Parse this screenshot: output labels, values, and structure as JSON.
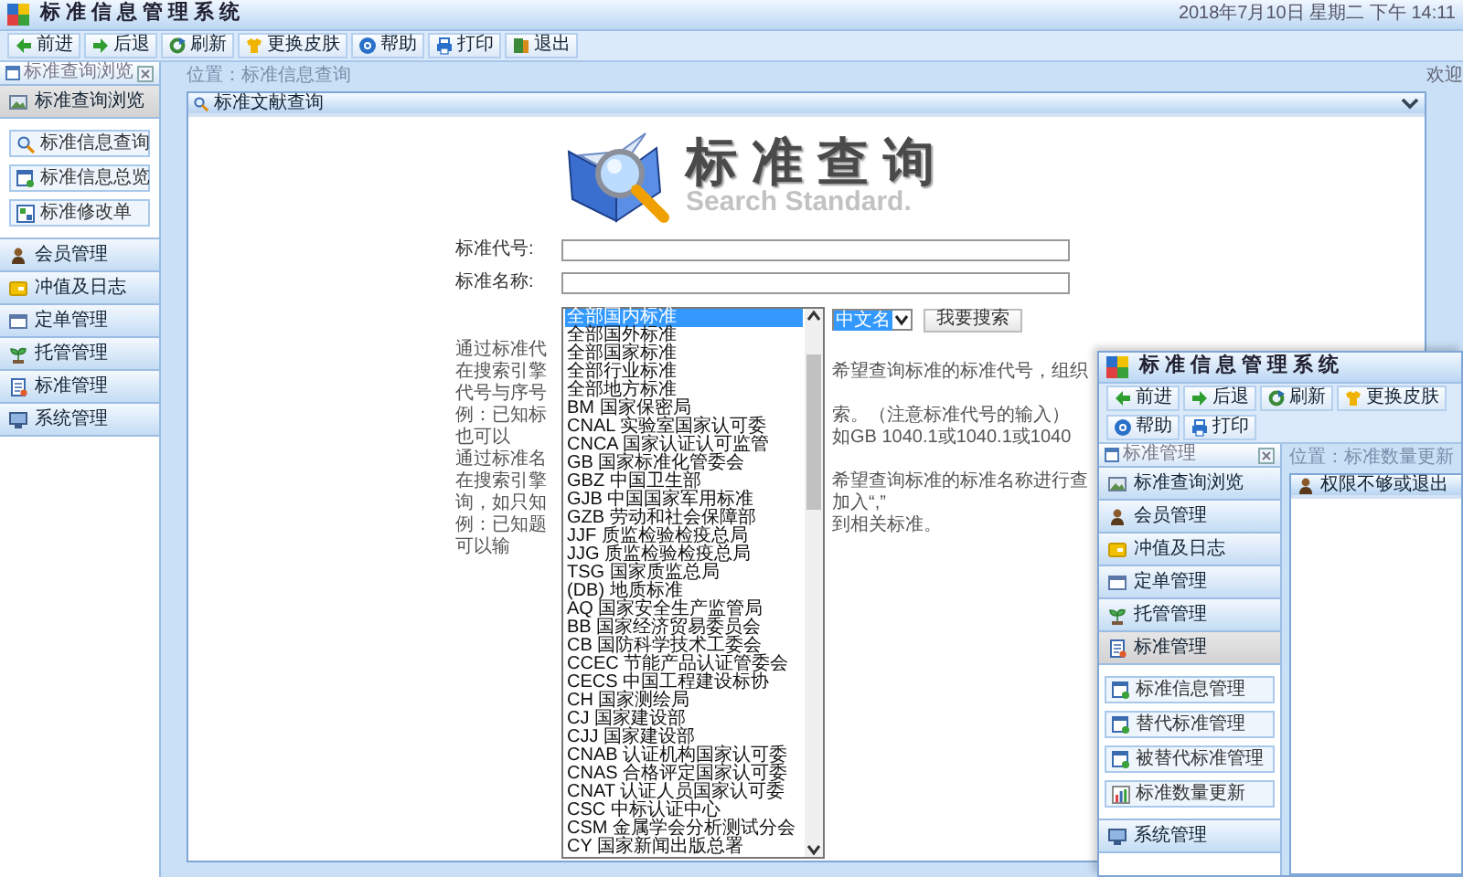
{
  "main_window": {
    "title": "标准信息管理系统",
    "datetime": "2018年7月10日 星期二 下午 14:11",
    "toolbar": [
      {
        "label": "前进",
        "kind": "forward"
      },
      {
        "label": "后退",
        "kind": "back"
      },
      {
        "label": "刷新",
        "kind": "refresh"
      },
      {
        "label": "更换皮肤",
        "kind": "skin"
      },
      {
        "label": "帮助",
        "kind": "help"
      },
      {
        "label": "打印",
        "kind": "print"
      },
      {
        "label": "退出",
        "kind": "exit"
      }
    ],
    "sidebar": {
      "header": "标准查询浏览",
      "sections": [
        {
          "label": "标准查询浏览",
          "kind": "browse",
          "expanded": true,
          "items": [
            {
              "label": "标准信息查询",
              "kind": "query"
            },
            {
              "label": "标准信息总览",
              "kind": "overview"
            },
            {
              "label": "标准修改单",
              "kind": "revision"
            }
          ]
        },
        {
          "label": "会员管理",
          "kind": "member",
          "expanded": false
        },
        {
          "label": "冲值及日志",
          "kind": "log",
          "expanded": false
        },
        {
          "label": "定单管理",
          "kind": "order",
          "expanded": false
        },
        {
          "label": "托管管理",
          "kind": "hosting",
          "expanded": false
        },
        {
          "label": "标准管理",
          "kind": "standard",
          "expanded": false
        },
        {
          "label": "系统管理",
          "kind": "system",
          "expanded": false
        }
      ]
    },
    "location": "位置：标准信息查询",
    "welcome": "欢迎",
    "panel": {
      "title": "标准文献查询",
      "logo_title": "标准查询",
      "logo_subtitle": "Search Standard.",
      "fields": [
        {
          "label": "标准代号:"
        },
        {
          "label": "标准名称:"
        }
      ],
      "category_list": [
        {
          "label": "全部国内标准",
          "selected": true
        },
        {
          "label": "全部国外标准",
          "selected": false
        },
        {
          "label": "全部国家标准",
          "selected": false
        },
        {
          "label": "全部行业标准",
          "selected": false
        },
        {
          "label": "全部地方标准",
          "selected": false
        },
        {
          "label": "BM 国家保密局",
          "selected": false
        },
        {
          "label": "CNAL 实验室国家认可委",
          "selected": false
        },
        {
          "label": "CNCA 国家认证认可监管",
          "selected": false
        },
        {
          "label": "GB 国家标准化管委会",
          "selected": false
        },
        {
          "label": "GBZ 中国卫生部",
          "selected": false
        },
        {
          "label": "GJB 中国国家军用标准",
          "selected": false
        },
        {
          "label": "GZB 劳动和社会保障部",
          "selected": false
        },
        {
          "label": "JJF 质监检验检疫总局",
          "selected": false
        },
        {
          "label": "JJG 质监检验检疫总局",
          "selected": false
        },
        {
          "label": "TSG 国家质监总局",
          "selected": false
        },
        {
          "label": "(DB) 地质标准",
          "selected": false
        },
        {
          "label": "AQ 国家安全生产监管局",
          "selected": false
        },
        {
          "label": "BB 国家经济贸易委员会",
          "selected": false
        },
        {
          "label": "CB 国防科学技术工委会",
          "selected": false
        },
        {
          "label": "CCEC 节能产品认证管委会",
          "selected": false
        },
        {
          "label": "CECS 中国工程建设标协",
          "selected": false
        },
        {
          "label": "CH 国家测绘局",
          "selected": false
        },
        {
          "label": "CJ 国家建设部",
          "selected": false
        },
        {
          "label": "CJJ 国家建设部",
          "selected": false
        },
        {
          "label": "CNAB 认证机构国家认可委",
          "selected": false
        },
        {
          "label": "CNAS 合格评定国家认可委",
          "selected": false
        },
        {
          "label": "CNAT 认证人员国家认可委",
          "selected": false
        },
        {
          "label": "CSC 中标认证中心",
          "selected": false
        },
        {
          "label": "CSM 金属学会分析测试分会",
          "selected": false
        },
        {
          "label": "CY 国家新闻出版总署",
          "selected": false
        }
      ],
      "language_select": "中文名",
      "search_button": "我要搜索",
      "help_lines": [
        {
          "left": "通过标准代"
        },
        {
          "left": "在搜索引擎",
          "right": "希望查询标准的标准代号，组织"
        },
        {
          "left": "代号与序号"
        },
        {
          "left": "例：已知标",
          "right": "索。（注意标准代号的输入）"
        },
        {
          "left": "也可以",
          "right": "如GB 1040.1或1040.1或1040"
        },
        {
          "left": "通过标准名"
        },
        {
          "left": "在搜索引擎",
          "right": "希望查询标准的标准名称进行查"
        },
        {
          "left": "询，如只知",
          "right": "加入“,”"
        },
        {
          "left": "例：已知题",
          "right": "到相关标准。"
        },
        {
          "left": "可以输"
        }
      ]
    }
  },
  "second_window": {
    "title": "标准信息管理系统",
    "toolbar": [
      {
        "label": "前进",
        "kind": "forward"
      },
      {
        "label": "后退",
        "kind": "back"
      },
      {
        "label": "刷新",
        "kind": "refresh"
      },
      {
        "label": "更换皮肤",
        "kind": "skin"
      },
      {
        "label": "帮助",
        "kind": "help"
      },
      {
        "label": "打印",
        "kind": "print"
      }
    ],
    "sidebar": {
      "header": "标准管理",
      "sections": [
        {
          "label": "标准查询浏览",
          "kind": "browse",
          "expanded": false
        },
        {
          "label": "会员管理",
          "kind": "member",
          "expanded": false
        },
        {
          "label": "冲值及日志",
          "kind": "log",
          "expanded": false
        },
        {
          "label": "定单管理",
          "kind": "order",
          "expanded": false
        },
        {
          "label": "托管管理",
          "kind": "hosting",
          "expanded": false
        },
        {
          "label": "标准管理",
          "kind": "standard",
          "expanded": true,
          "items": [
            {
              "label": "标准信息管理",
              "kind": "overview"
            },
            {
              "label": "替代标准管理",
              "kind": "overview"
            },
            {
              "label": "被替代标准管理",
              "kind": "overview"
            },
            {
              "label": "标准数量更新",
              "kind": "chart"
            }
          ]
        },
        {
          "label": "系统管理",
          "kind": "system",
          "expanded": false
        }
      ]
    },
    "location": "位置：标准数量更新",
    "panel": {
      "title": "权限不够或退出"
    }
  }
}
